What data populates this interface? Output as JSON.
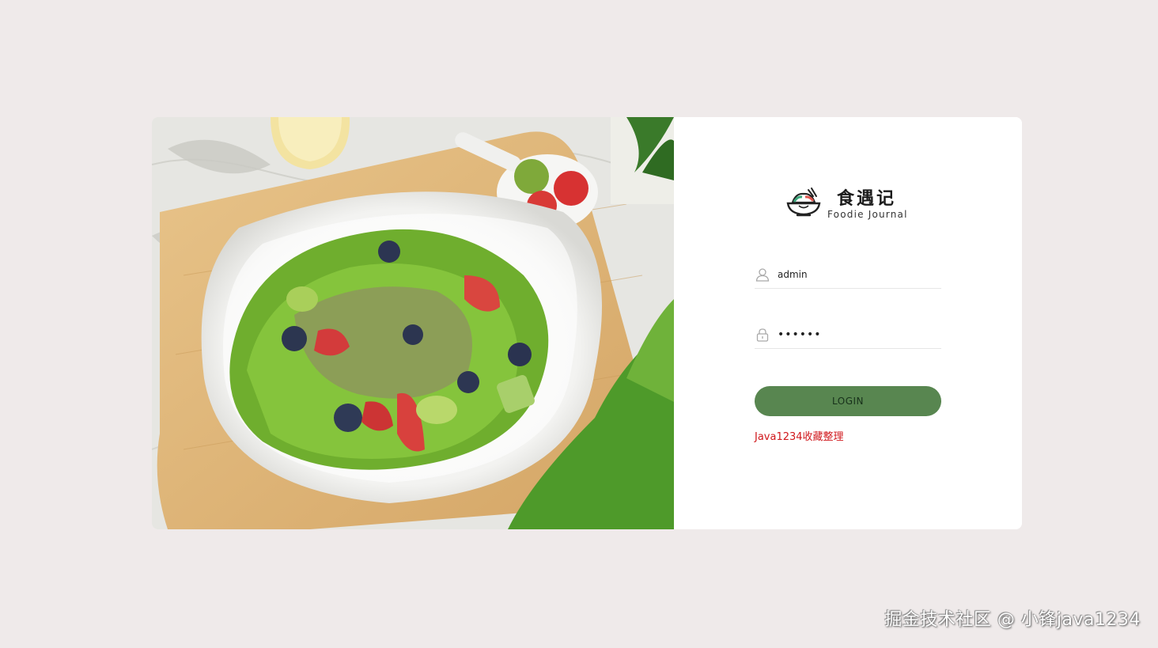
{
  "brand": {
    "name_cn": "食遇记",
    "name_en": "Foodie Journal",
    "icon": "bowl-logo-icon"
  },
  "form": {
    "username_value": "admin",
    "password_value": "••••••",
    "username_icon": "user-icon",
    "password_icon": "lock-icon",
    "login_label": "LOGIN",
    "notice": "Java1234收藏整理"
  },
  "photo": {
    "subject": "salad-photo"
  },
  "watermark": "掘金技术社区 @ 小锋java1234",
  "colors": {
    "background": "#efeaea",
    "button": "#588650",
    "notice": "#d0181c"
  }
}
